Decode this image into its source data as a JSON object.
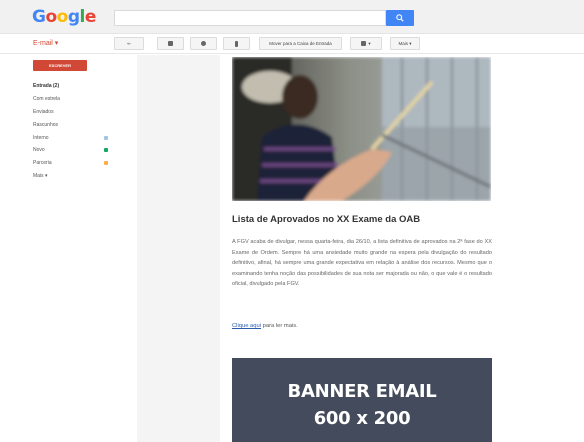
{
  "header": {
    "logo_letters": [
      {
        "char": "G",
        "color": "#4285f4"
      },
      {
        "char": "o",
        "color": "#ea4335"
      },
      {
        "char": "o",
        "color": "#fbbc05"
      },
      {
        "char": "g",
        "color": "#4285f4"
      },
      {
        "char": "l",
        "color": "#34a853"
      },
      {
        "char": "e",
        "color": "#ea4335"
      }
    ],
    "search_placeholder": "",
    "search_icon": "search-icon"
  },
  "toolbar": {
    "app_label": "E-mail ▾",
    "back_label": "⇐",
    "archive_icon": "archive-icon",
    "spam_icon": "spam-icon",
    "delete_icon": "trash-icon",
    "move_label": "Mover para a Caixa de Entrada",
    "labels_label": "▾",
    "more_label": "Mais ▾"
  },
  "sidebar": {
    "compose_label": "ESCREVER",
    "items": [
      {
        "label": "Entrada (2)",
        "bold": true,
        "color": ""
      },
      {
        "label": "Com estrela",
        "bold": false,
        "color": ""
      },
      {
        "label": "Enviados",
        "bold": false,
        "color": ""
      },
      {
        "label": "Rascunhos",
        "bold": false,
        "color": ""
      },
      {
        "label": "Interno",
        "bold": false,
        "color": "#9fc6e7"
      },
      {
        "label": "Novo",
        "bold": false,
        "color": "#16a765"
      },
      {
        "label": "Parceria",
        "bold": false,
        "color": "#ffad46"
      },
      {
        "label": "Mais ▾",
        "bold": false,
        "color": ""
      }
    ]
  },
  "email": {
    "headline": "Lista de Aprovados no XX Exame da OAB",
    "body": "A FGV acaba de divulgar, nessa quarta-feira, dia 26/10, a lista definitiva de aprovados na 2ª fase do XX Exame de Ordem. Sempre há uma ansiedade muito grande na espera pela divulgação do resultado definitivo, afinal, há sempre uma grande expectativa em relação à análise dos recursos. Mesmo que o examinando tenha noção das possibilidades de sua nota ser majorada ou não, o que vale é o resultado oficial, divulgado pela FGV.",
    "link_text": "Clique aqui",
    "link_suffix": " para ler mais.",
    "banner_line1": "BANNER EMAIL",
    "banner_line2": "600 x 200"
  }
}
